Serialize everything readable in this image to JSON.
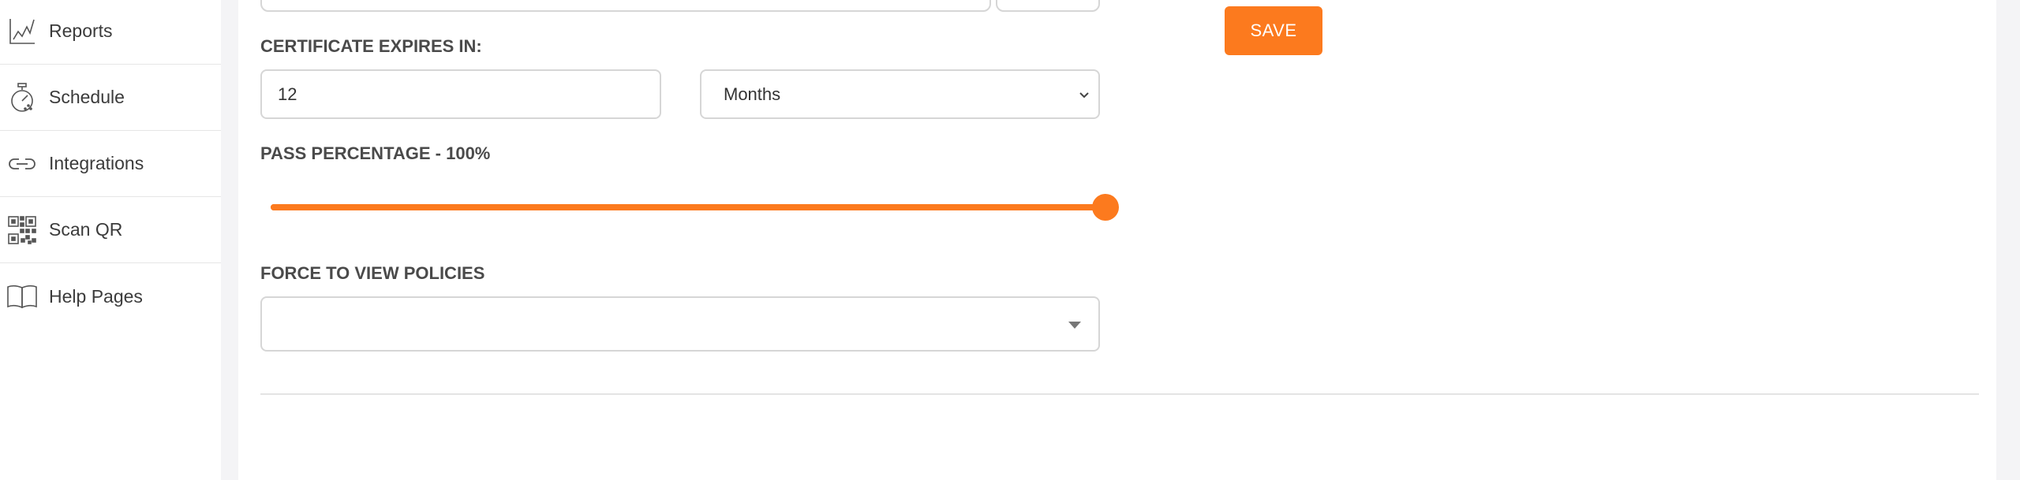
{
  "sidebar": {
    "items": [
      {
        "label": "Reports",
        "icon": "chart-line-icon"
      },
      {
        "label": "Schedule",
        "icon": "stopwatch-icon"
      },
      {
        "label": "Integrations",
        "icon": "link-icon"
      },
      {
        "label": "Scan QR",
        "icon": "qr-code-icon"
      },
      {
        "label": "Help Pages",
        "icon": "book-icon"
      }
    ]
  },
  "form": {
    "save_label": "SAVE",
    "certificate_label": "CERTIFICATE EXPIRES IN:",
    "certificate_value": "12",
    "certificate_unit": "Months",
    "pass_label": "PASS PERCENTAGE - 100%",
    "pass_percentage": 100,
    "policies_label": "FORCE TO VIEW POLICIES",
    "policies_value": ""
  },
  "colors": {
    "accent": "#fc7a1e",
    "border": "#d6d6d6"
  }
}
